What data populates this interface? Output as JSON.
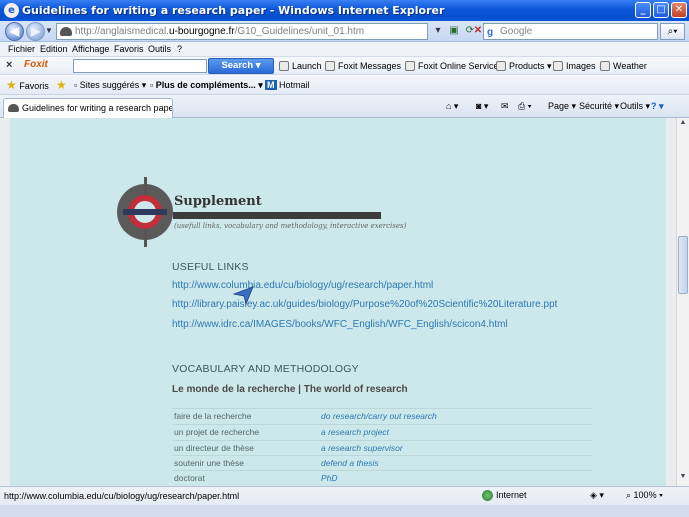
{
  "window": {
    "title": "Guidelines for writing a research paper - Windows Internet Explorer",
    "minimize": "_",
    "maximize": "□",
    "close": "✕"
  },
  "addressbar": {
    "url_prefix": "http://anglaismedical.",
    "url_host": "u-bourgogne.fr",
    "url_path": "/G10_Guidelines/unit_01.htm",
    "search_placeholder": "Google"
  },
  "menu": [
    "Fichier",
    "Edition",
    "Affichage",
    "Favoris",
    "Outils",
    "?"
  ],
  "foxit": {
    "logo": "Foxit",
    "search_button": "Search",
    "items": [
      "Launch",
      "Foxit Messages",
      "Foxit Online Services",
      "Products",
      "Images",
      "Weather"
    ]
  },
  "favorites": {
    "favoris": "Favoris",
    "sites": "Sites suggérés",
    "more": "Plus de compléments...",
    "hotmail": "Hotmail"
  },
  "tab": {
    "label": "Guidelines for writing a research paper"
  },
  "commands": {
    "page": "Page",
    "security": "Sécurité",
    "tools": "Outils"
  },
  "content": {
    "supplement_title": "Supplement",
    "supplement_subtitle": "(usefull links, vocabulary and methodology, interactive exercises)",
    "useful_links_heading": "USEFUL LINKS",
    "links": [
      "http://www.columbia.edu/cu/biology/ug/research/paper.html",
      "http://library.paisley.ac.uk/guides/biology/Purpose%20of%20Scientific%20Literature.ppt",
      "http://www.idrc.ca/IMAGES/books/WFC_English/WFC_English/scicon4.html"
    ],
    "vocab_heading": "VOCABULARY AND METHODOLOGY",
    "vocab_subheading": "Le monde de la recherche | The world of research",
    "vocab_rows": [
      {
        "fr": "faire de la recherche",
        "en": "do research/carry out research"
      },
      {
        "fr": "un projet de recherche",
        "en": "a research project"
      },
      {
        "fr": "un directeur de thèse",
        "en": "a research supervisor"
      },
      {
        "fr": "soutenir une thèse",
        "en": "defend a thesis"
      },
      {
        "fr": "doctorat",
        "en": "PhD"
      }
    ]
  },
  "status": {
    "url": "http://www.columbia.edu/cu/biology/ug/research/paper.html",
    "zone": "Internet",
    "zoom": "100%"
  }
}
